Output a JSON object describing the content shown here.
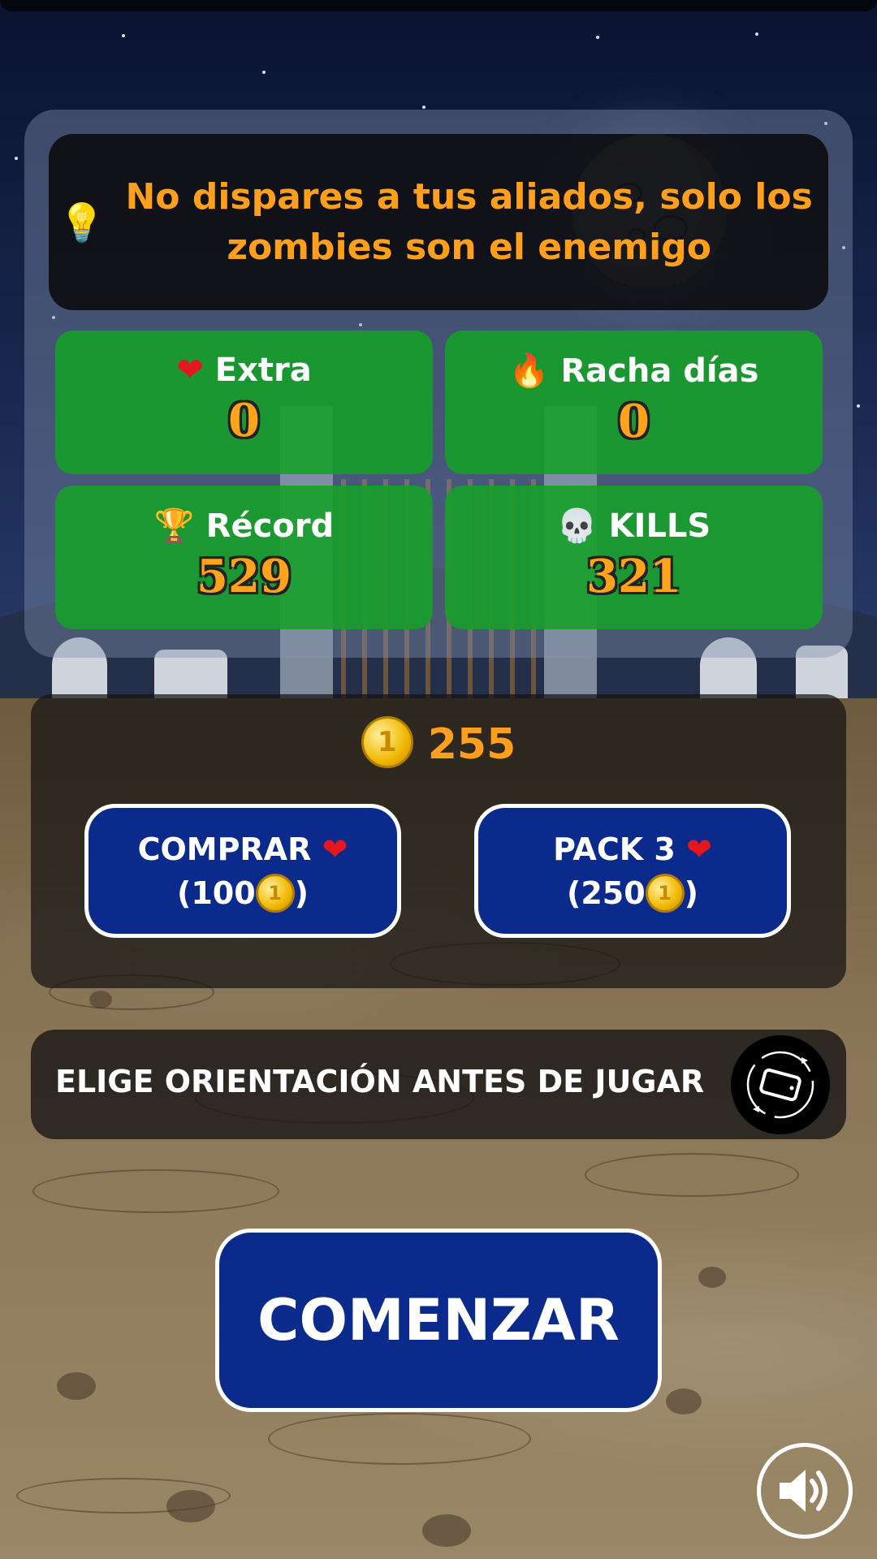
{
  "tip": {
    "icon": "lightbulb-icon",
    "text": "No dispares a tus aliados, solo los zombies son el enemigo"
  },
  "stats": {
    "extra": {
      "icon": "heart-icon",
      "label": "Extra",
      "value": "0"
    },
    "streak": {
      "icon": "fire-icon",
      "label": "Racha días",
      "value": "0"
    },
    "record": {
      "icon": "trophy-icon",
      "label": "Récord",
      "value": "529"
    },
    "kills": {
      "icon": "skull-icon",
      "label": "KILLS",
      "value": "321"
    }
  },
  "shop": {
    "coin_icon": "coin-icon",
    "balance": "255",
    "buy_one": {
      "line1": "COMPRAR",
      "price_open": "(100",
      "price_close": ")"
    },
    "buy_pack": {
      "line1": "PACK 3",
      "price_open": "(250",
      "price_close": ")"
    }
  },
  "orientation": {
    "label": "ELIGE ORIENTACIÓN ANTES DE JUGAR",
    "icon": "rotate-device-icon"
  },
  "start_button": "COMENZAR",
  "sound_icon": "speaker-icon",
  "colors": {
    "accent_orange": "#ff9f1c",
    "card_green": "#14a028",
    "button_blue": "#0a2a8c",
    "heart_red": "#e3171d"
  }
}
